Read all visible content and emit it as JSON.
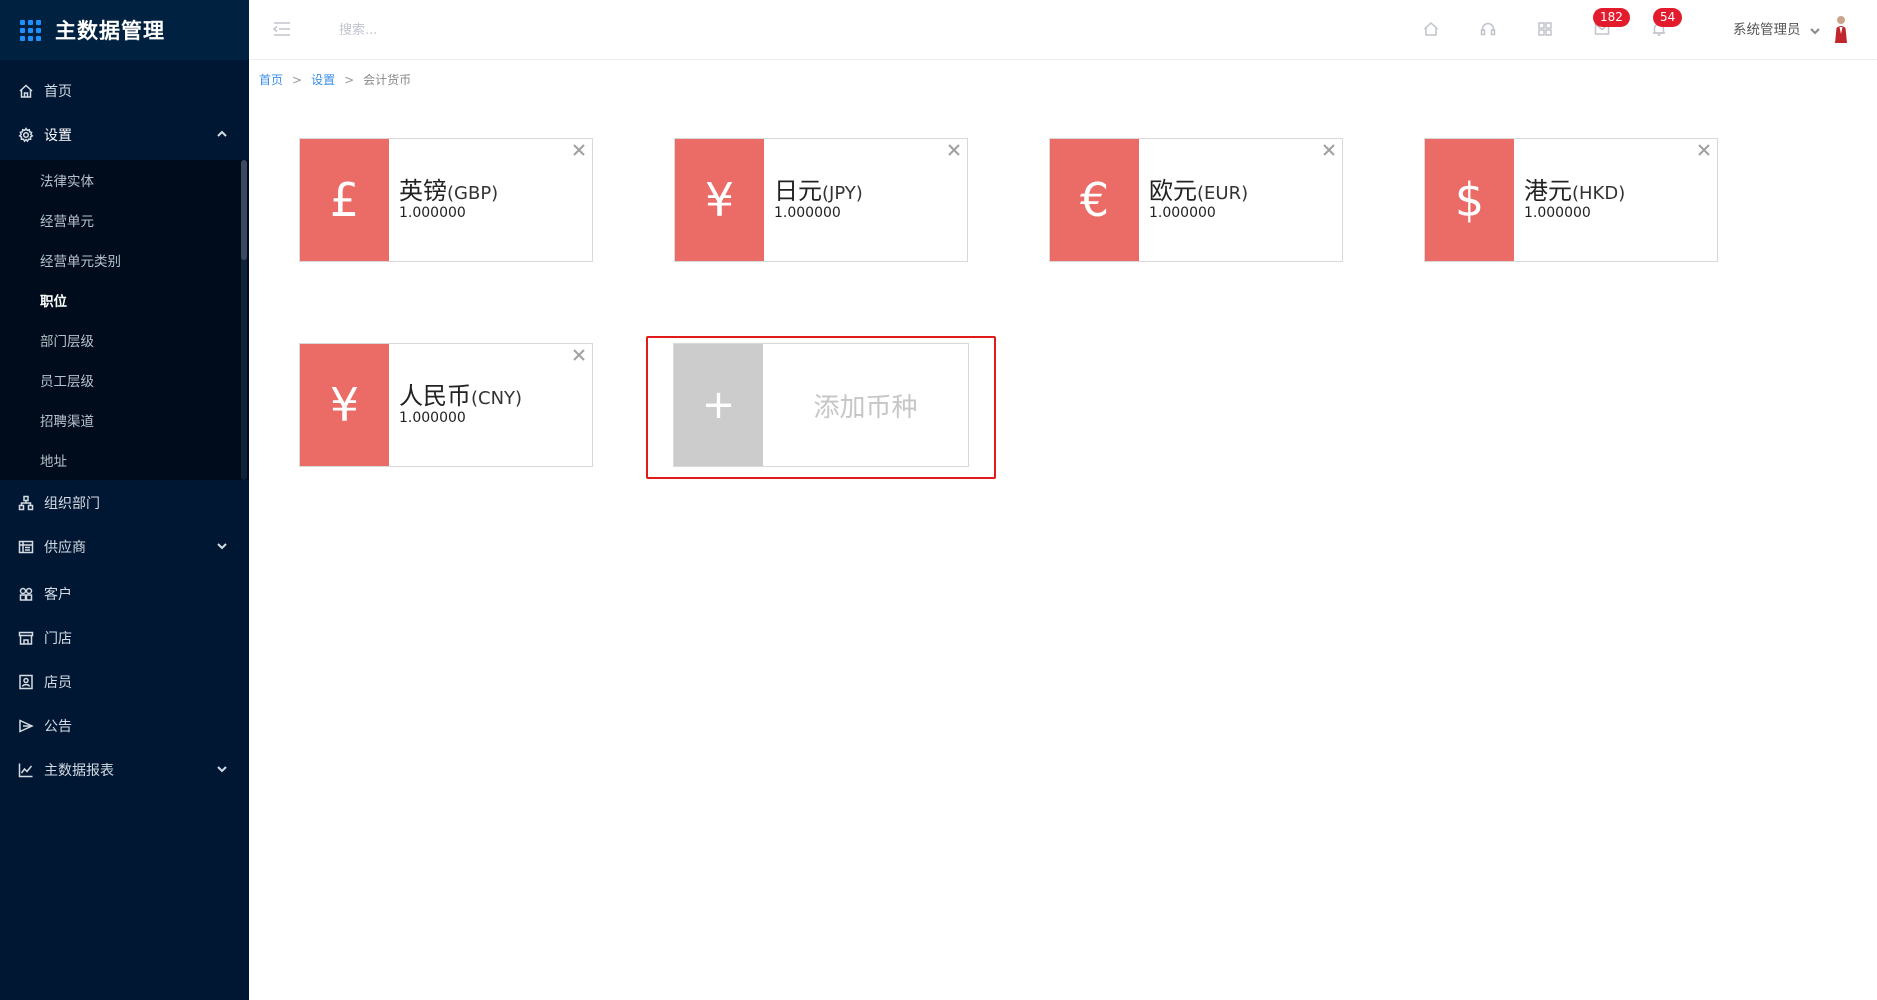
{
  "app": {
    "title": "主数据管理"
  },
  "sidebar": {
    "items": [
      {
        "label": "首页",
        "icon": "home-icon"
      },
      {
        "label": "设置",
        "icon": "gear-icon",
        "expanded": true
      },
      {
        "label": "组织部门",
        "icon": "org-chart-icon"
      },
      {
        "label": "供应商",
        "icon": "supplier-icon",
        "collapsible": true
      },
      {
        "label": "客户",
        "icon": "customer-icon"
      },
      {
        "label": "门店",
        "icon": "store-icon"
      },
      {
        "label": "店员",
        "icon": "clerk-icon"
      },
      {
        "label": "公告",
        "icon": "announcement-icon"
      },
      {
        "label": "主数据报表",
        "icon": "report-chart-icon",
        "collapsible": true
      }
    ],
    "settings_submenu": [
      {
        "label": "法律实体"
      },
      {
        "label": "经营单元"
      },
      {
        "label": "经营单元类别"
      },
      {
        "label": "职位",
        "active": true
      },
      {
        "label": "部门层级"
      },
      {
        "label": "员工层级"
      },
      {
        "label": "招聘渠道"
      },
      {
        "label": "地址"
      }
    ]
  },
  "header": {
    "search": {
      "placeholder": "搜索...",
      "value": ""
    },
    "icons": [
      "home-icon",
      "headset-icon",
      "apps-grid-icon",
      "mail-icon",
      "bell-icon"
    ],
    "mail_badge": "182",
    "bell_badge": "54",
    "user_name": "系统管理员"
  },
  "breadcrumb": {
    "items": [
      "首页",
      "设置"
    ],
    "current": "会计货币"
  },
  "currencies": [
    {
      "symbol": "£",
      "name": "英镑",
      "code": "(GBP)",
      "rate": "1.000000"
    },
    {
      "symbol": "¥",
      "name": "日元",
      "code": "(JPY)",
      "rate": "1.000000"
    },
    {
      "symbol": "€",
      "name": "欧元",
      "code": "(EUR)",
      "rate": "1.000000"
    },
    {
      "symbol": "$",
      "name": "港元",
      "code": "(HKD)",
      "rate": "1.000000"
    },
    {
      "symbol": "¥",
      "name": "人民币",
      "code": "(CNY)",
      "rate": "1.000000"
    }
  ],
  "add_currency": {
    "symbol": "+",
    "label": "添加币种"
  },
  "colors": {
    "sidebar_bg": "#001733",
    "submenu_bg": "#000c1c",
    "accent_symbol": "#eb6b66",
    "badge": "#e21b2d",
    "highlight_outline": "#e31a1a",
    "link": "#3b8fe8"
  }
}
